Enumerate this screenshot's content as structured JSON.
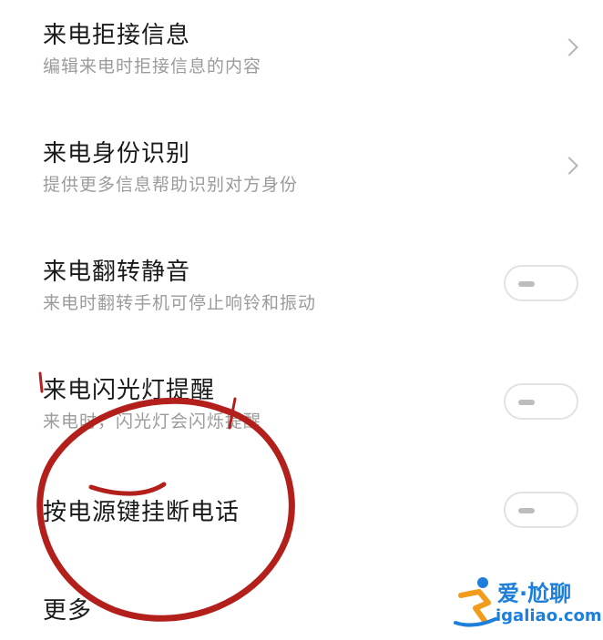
{
  "settings": {
    "items": [
      {
        "title": "来电拒接信息",
        "subtitle": "编辑来电时拒接信息的内容"
      },
      {
        "title": "来电身份识别",
        "subtitle": "提供更多信息帮助识别对方身份"
      },
      {
        "title": "来电翻转静音",
        "subtitle": "来电时翻转手机可停止响铃和振动",
        "toggle_on": false
      },
      {
        "title": "来电闪光灯提醒",
        "subtitle": "来电时，闪光灯会闪烁提醒",
        "toggle_on": false
      },
      {
        "title": "按电源键挂断电话",
        "toggle_on": false
      },
      {
        "title": "更多"
      }
    ]
  },
  "watermark": {
    "brand": "爱·尬聊",
    "url": "igaliao.com",
    "color": "#1d7fd9"
  },
  "annotation_color": "#b3201c"
}
